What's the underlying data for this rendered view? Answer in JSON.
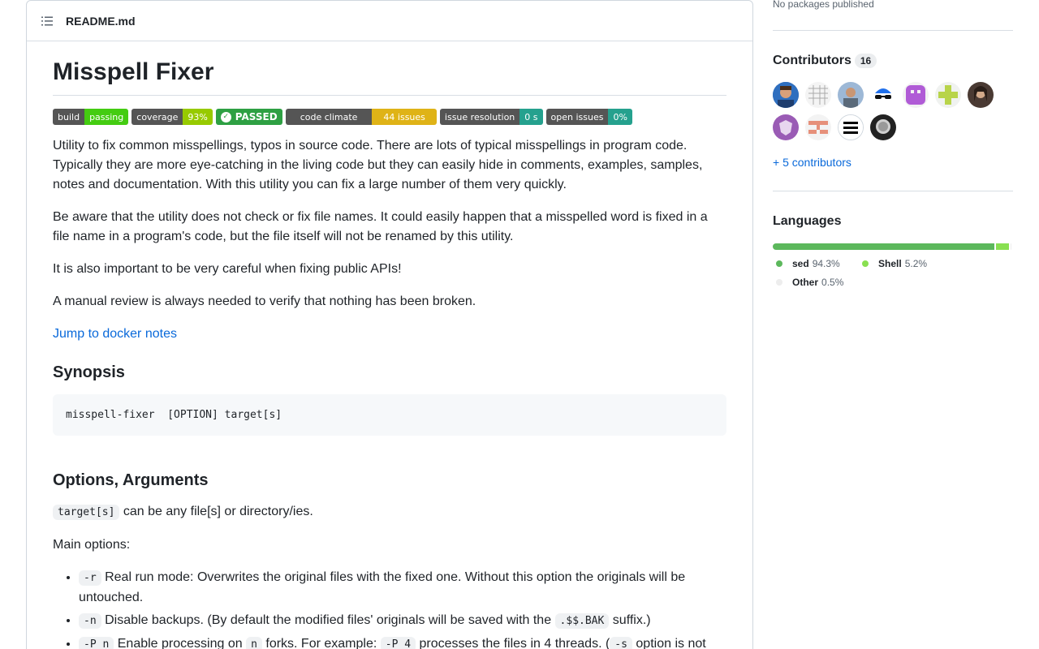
{
  "readme": {
    "filename": "README.md",
    "title": "Misspell Fixer",
    "badges": [
      {
        "left": "build",
        "right": "passing",
        "color": "#44cc11"
      },
      {
        "left": "coverage",
        "right": "93%",
        "color": "#97ca00"
      },
      {
        "text": "PASSED",
        "color": "#2ea043"
      },
      {
        "left": "code climate",
        "right": "44 issues",
        "color": "#dfb317"
      },
      {
        "left": "issue resolution",
        "right": "0 s",
        "color": "#25a18e"
      },
      {
        "left": "open issues",
        "right": "0%",
        "color": "#25a18e"
      }
    ],
    "paragraphs": [
      "Utility to fix common misspellings, typos in source code. There are lots of typical misspellings in program code. Typically they are more eye-catching in the living code but they can easily hide in comments, examples, samples, notes and documentation. With this utility you can fix a large number of them very quickly.",
      "Be aware that the utility does not check or fix file names. It could easily happen that a misspelled word is fixed in a file name in a program's code, but the file itself will not be renamed by this utility.",
      "It is also important to be very careful when fixing public APIs!",
      "A manual review is always needed to verify that nothing has been broken."
    ],
    "docker_link": "Jump to docker notes",
    "synopsis_heading": "Synopsis",
    "synopsis_code": "misspell-fixer  [OPTION] target[s]",
    "options_heading": "Options, Arguments",
    "target_code": "target[s]",
    "target_text": " can be any file[s] or directory/ies.",
    "main_options": "Main options:",
    "options": [
      {
        "flag": "-r",
        "text": " Real run mode: Overwrites the original files with the fixed one. Without this option the originals will be untouched."
      },
      {
        "flag": "-n",
        "text_before": " Disable backups. (By default the modified files' originals will be saved with the ",
        "code": ".$$.BAK",
        "text_after": " suffix.)"
      },
      {
        "flag": "-P n",
        "text_before": " Enable processing on ",
        "code": "n",
        "text_mid": " forks. For example: ",
        "code2": "-P 4",
        "text_after": " processes the files in 4 threads. (",
        "code3": "-s",
        "text_end": " option is not"
      }
    ]
  },
  "sidebar": {
    "packages_text": "No packages published",
    "contributors_heading": "Contributors",
    "contributors_count": "16",
    "more_contributors": "+ 5 contributors",
    "languages_heading": "Languages",
    "languages": [
      {
        "name": "sed",
        "percent": "94.3%",
        "value": 94.3,
        "color": "#5cb85c"
      },
      {
        "name": "Shell",
        "percent": "5.2%",
        "value": 5.2,
        "color": "#89e051"
      },
      {
        "name": "Other",
        "percent": "0.5%",
        "value": 0.5,
        "color": "#ededed"
      }
    ]
  }
}
